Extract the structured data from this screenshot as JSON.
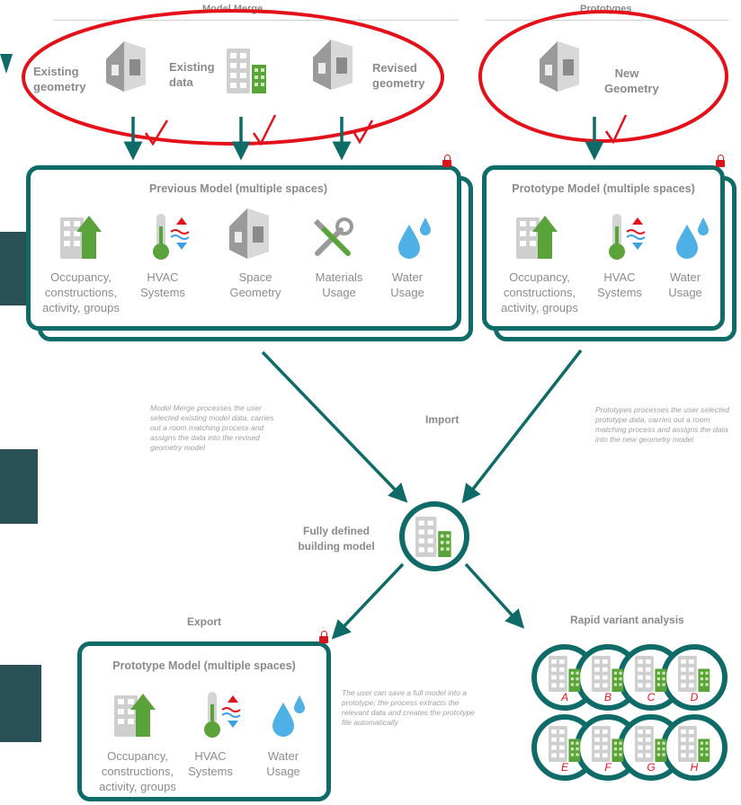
{
  "top": {
    "model_merge_title": "Model Merge",
    "prototypes_title": "Prototypes",
    "existing_geometry": "Existing geometry",
    "existing_data": "Existing data",
    "revised_geometry": "Revised geometry",
    "new_geometry": "New Geometry"
  },
  "previous_model": {
    "title": "Previous Model (multiple spaces)",
    "items": [
      {
        "label": "Occupancy, constructions, activity, groups",
        "icon": "building-up-arrow-icon"
      },
      {
        "label": "HVAC Systems",
        "icon": "thermometer-icon"
      },
      {
        "label": "Space Geometry",
        "icon": "house-icon"
      },
      {
        "label": "Materials Usage",
        "icon": "tools-icon"
      },
      {
        "label": "Water Usage",
        "icon": "water-drops-icon"
      }
    ]
  },
  "prototype_model_top": {
    "title": "Prototype Model (multiple spaces)",
    "items": [
      {
        "label": "Occupancy, constructions, activity, groups",
        "icon": "building-up-arrow-icon"
      },
      {
        "label": "HVAC Systems",
        "icon": "thermometer-icon"
      },
      {
        "label": "Water Usage",
        "icon": "water-drops-icon"
      }
    ]
  },
  "notes": {
    "model_merge_note": "Model Merge processes the user selected existing model data, carries out a room matching process and assigns the data into the revised geometry model",
    "prototypes_note": "Prototypes processes the user selected prototype data, carries out a room matching process and assigns the data into the new geometry model",
    "export_note": "The user can save a full model into a prototype; the process extracts the relevant data and creates the prototype file automatically"
  },
  "center": {
    "import_label": "Import",
    "fully_defined": "Fully defined building model",
    "export_label": "Export",
    "rapid_variant": "Rapid variant analysis"
  },
  "prototype_model_bottom": {
    "title": "Prototype Model (multiple spaces)",
    "items": [
      {
        "label": "Occupancy, constructions, activity, groups",
        "icon": "building-up-arrow-icon"
      },
      {
        "label": "HVAC Systems",
        "icon": "thermometer-icon"
      },
      {
        "label": "Water Usage",
        "icon": "water-drops-icon"
      }
    ]
  },
  "variants": [
    "A",
    "B",
    "C",
    "D",
    "E",
    "F",
    "G",
    "H"
  ],
  "colors": {
    "teal": "#0f6b68",
    "red": "#e3121a",
    "green": "#5aa33a",
    "gray_text": "#8a8a8a",
    "dark_block": "#2a5156"
  }
}
